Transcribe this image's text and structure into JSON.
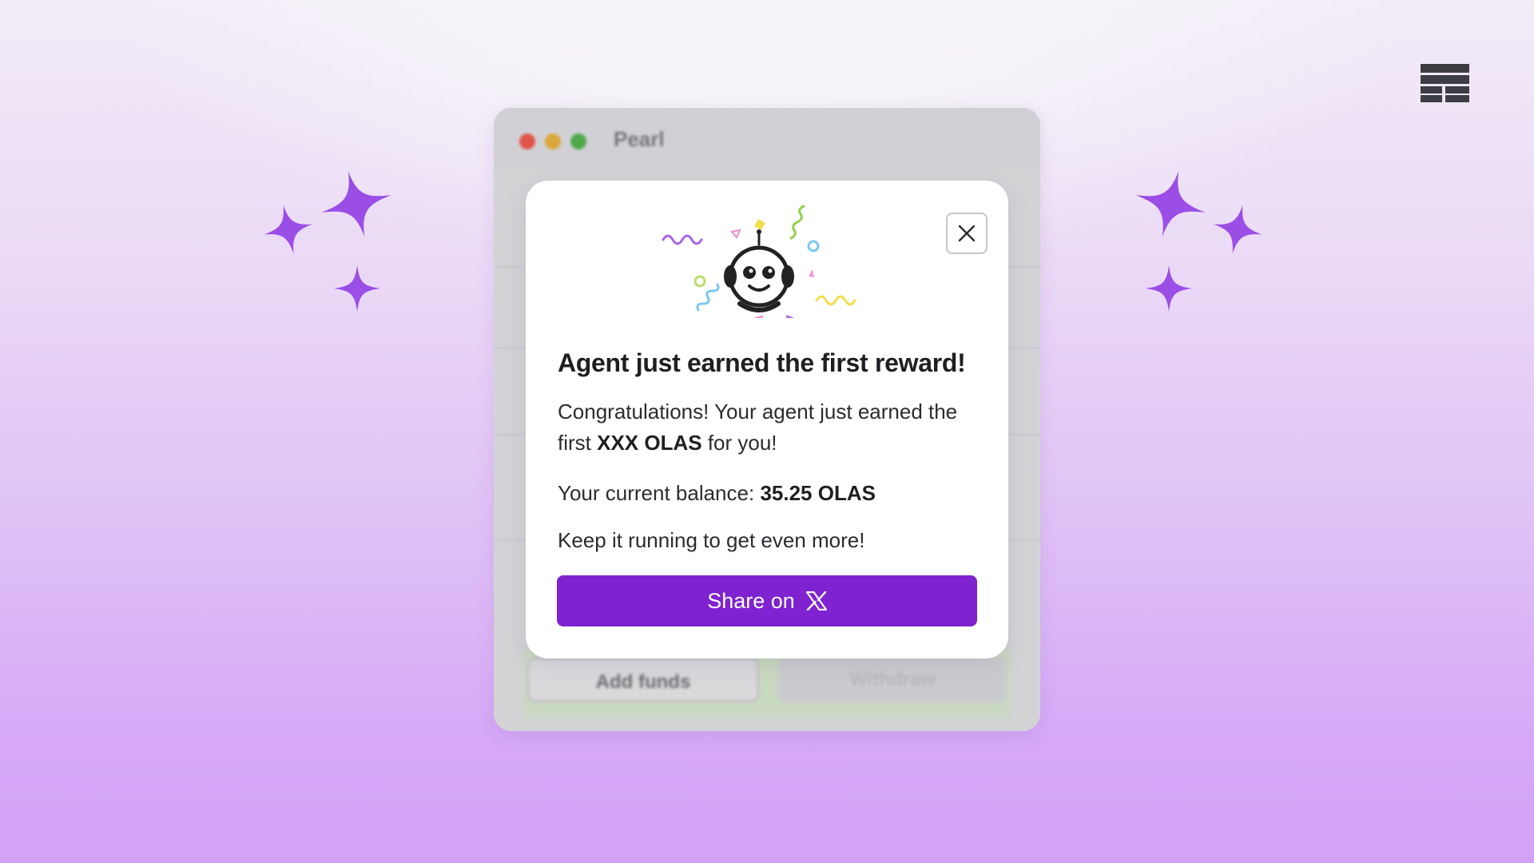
{
  "app": {
    "window_title": "Pearl"
  },
  "background_buttons": {
    "add_funds": "Add funds",
    "withdraw": "Withdraw"
  },
  "modal": {
    "title": "Agent just earned the first reward!",
    "congrats_prefix": "Congratulations! Your agent just earned the first ",
    "reward_amount": "XXX OLAS",
    "congrats_suffix": " for you!",
    "balance_label": "Your current balance: ",
    "balance_value": "35.25 OLAS",
    "keep_running": "Keep it running to get even more!",
    "share_label": "Share on",
    "share_icon": "x-logo-icon",
    "close_icon": "close-icon"
  },
  "colors": {
    "accent": "#7f22cf",
    "sparkle": "#9b4ee6",
    "logo": "#3d3e43"
  }
}
